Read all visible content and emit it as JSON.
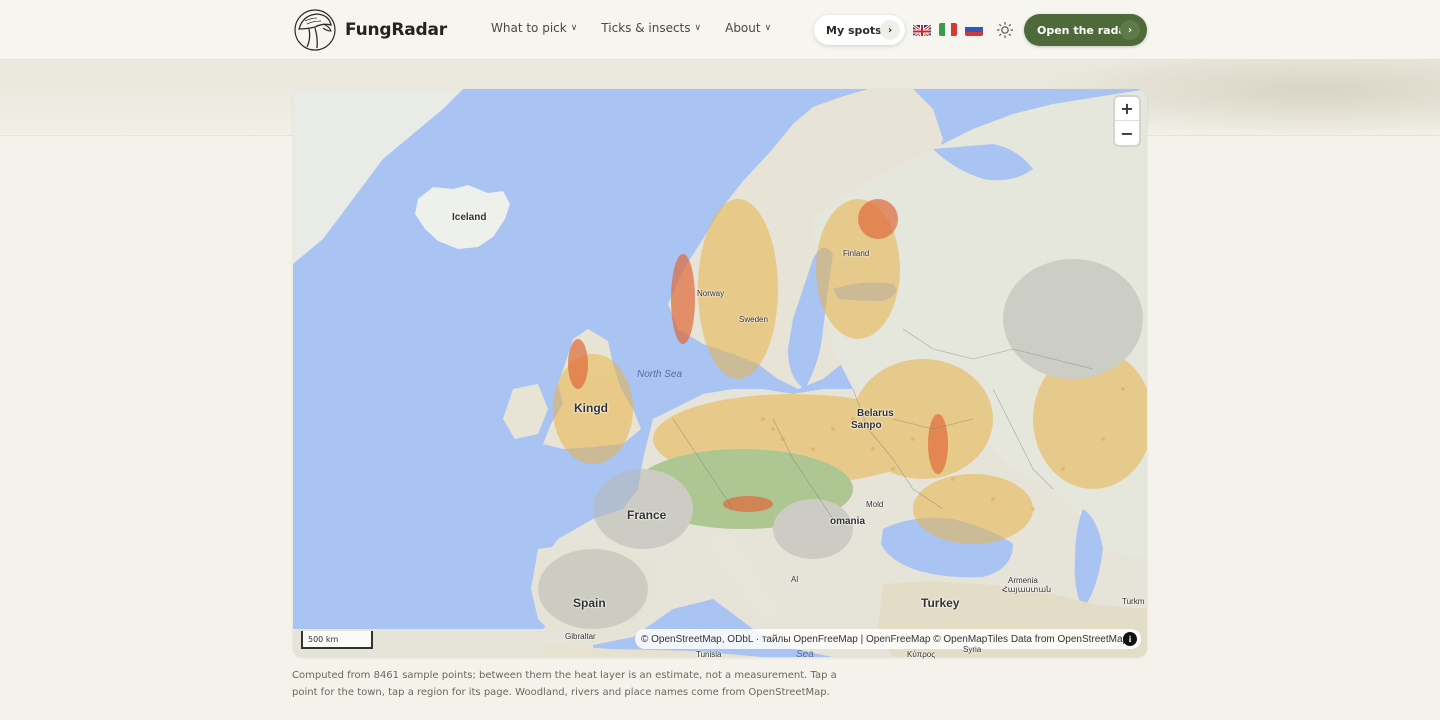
{
  "brand": {
    "name": "FungRadar",
    "logo_icon": "mushroom-icon"
  },
  "nav": [
    {
      "label": "What to pick"
    },
    {
      "label": "Ticks & insects"
    },
    {
      "label": "About"
    }
  ],
  "header": {
    "spots_label": "My spots",
    "radar_label": "Open the radar",
    "languages": [
      "uk-flag-icon",
      "it-flag-icon",
      "ru-flag-icon"
    ],
    "theme_icon": "sun-icon",
    "accent_color": "#4f6a3a"
  },
  "map": {
    "zoom_in": "+",
    "zoom_out": "−",
    "scale_label": "500 km",
    "attribution": "© OpenStreetMap, ODbL · тайлы OpenFreeMap | OpenFreeMap © OpenMapTiles Data from OpenStreetMap",
    "info_label": "i",
    "labels": {
      "iceland": "Iceland",
      "norway": "Norway",
      "sweden": "Sweden",
      "finland": "Finland",
      "north_sea": "North Sea",
      "kingdom": "Kingd",
      "belarus": "Belarus",
      "sanpo": "Sanpo",
      "france": "France",
      "romania": "omania",
      "moldova": "Mold",
      "turkey": "Turkey",
      "turkmen": "Turkm",
      "armenia": "Armenia",
      "armenia_native": "Հայաստան",
      "spain": "Spain",
      "gibraltar": "Gibraltar",
      "tunisia": "Tunisia",
      "sea": "Sea",
      "kypros": "Κύπρος",
      "syria": "Syria",
      "al": "Al"
    },
    "heat_colors": {
      "low": "#7fae5a",
      "mid": "#e8b44a",
      "high": "#e06a3a",
      "none": "#b9bab5"
    }
  },
  "caption": "Computed from 8461 sample points; between them the heat layer is an estimate, not a measurement. Tap a point for the town, tap a region for its page. Woodland, rivers and place names come from OpenStreetMap."
}
